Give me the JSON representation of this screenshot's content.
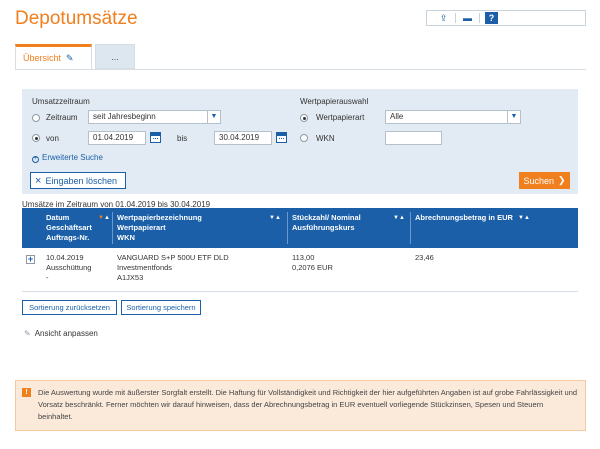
{
  "page": {
    "title": "Depotumsätze"
  },
  "toolbar": {
    "export_icon": "export-icon",
    "print_icon": "print-icon",
    "help_label": "?"
  },
  "tabs": [
    {
      "label": "Übersicht",
      "active": true
    },
    {
      "label": "..."
    }
  ],
  "filter": {
    "section_left": "Umsatzzeitraum",
    "section_right": "Wertpapierauswahl",
    "zeitraum_label": "Zeitraum",
    "zeitraum_value": "seit Jahresbeginn",
    "von_label": "von",
    "von_value": "01.04.2019",
    "bis_label": "bis",
    "bis_value": "30.04.2019",
    "wertpapierart_label": "Wertpapierart",
    "wertpapierart_value": "Alle",
    "wkn_label": "WKN",
    "wkn_value": "",
    "extended_search": "Erweiterte Suche",
    "clear_button": "Eingaben löschen",
    "search_button": "Suchen"
  },
  "results": {
    "range_text": "Umsätze im Zeitraum von 01.04.2019 bis 30.04.2019",
    "columns": [
      {
        "lines": [
          "Datum",
          "Geschäftsart",
          "Auftrags-Nr."
        ]
      },
      {
        "lines": [
          "Wertpapierbezeichnung",
          "Wertpapierart",
          "WKN"
        ]
      },
      {
        "lines": [
          "Stückzahl/ Nominal",
          "Ausführungskurs",
          ""
        ]
      },
      {
        "lines": [
          "Abrechnungsbetrag in EUR",
          "",
          ""
        ]
      }
    ],
    "rows": [
      {
        "date": "10.04.2019",
        "type": "Ausschüttung",
        "order": "-",
        "name": "VANGUARD S+P 500U ETF DLD",
        "category": "Investmentfonds",
        "wkn": "A1JX53",
        "quantity": "113,00",
        "price": "0,2076 EUR",
        "amount": "23,46"
      }
    ]
  },
  "actions": {
    "reset_sort": "Sortierung zurücksetzen",
    "save_sort": "Sortierung speichern",
    "adjust_view": "Ansicht anpassen"
  },
  "notice": {
    "text": "Die Auswertung wurde mit äußerster Sorgfalt erstellt. Die Haftung für Vollständigkeit und Richtigkeit der hier aufgeführten Angaben ist auf grobe Fahrlässigkeit und Vorsatz beschränkt. Ferner möchten wir darauf hinweisen, dass der Abrechnungsbetrag in EUR eventuell vorliegende Stückzinsen, Spesen und Steuern beinhaltet."
  },
  "colors": {
    "accent": "#f07f1e",
    "primary": "#1a5fa8",
    "panel": "#e2ebf3"
  }
}
